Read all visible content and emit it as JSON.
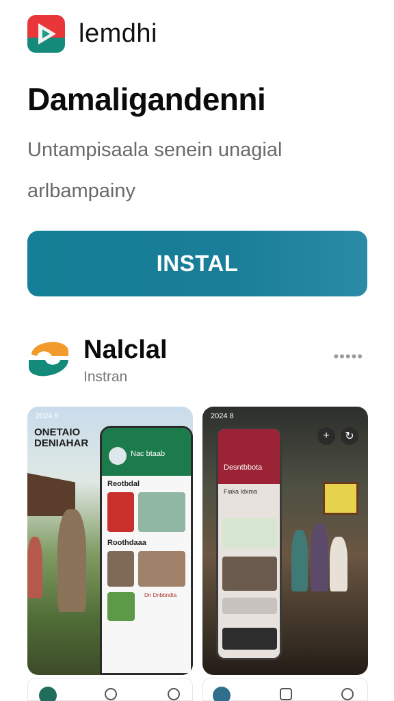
{
  "app": {
    "name": "lemdhi",
    "title": "Damaligandenni",
    "subtitle_line1": "Untampisaala senein unagial",
    "subtitle_line2": "arlbampainy",
    "install_label": "INSTAL"
  },
  "related_app": {
    "name": "Nalclal",
    "subtitle": "Instran",
    "more_label": "•••••"
  },
  "screenshots": [
    {
      "status_time": "2024 8",
      "overlay_text_line1": "ONETAIO",
      "overlay_text_line2": "DENIAHAR",
      "phone_header": "Nac btaab",
      "section1": "Reotbdal",
      "section2": "Roothdaaa",
      "caption": "Dn Dnbbndta"
    },
    {
      "status_time": "2024 8",
      "phone_header": "Desntbbota",
      "card_label": "Fiaka Idxma"
    }
  ],
  "colors": {
    "install_button": "#1a7e99",
    "logo_red": "#e8363a",
    "logo_teal": "#138a7a",
    "logo_orange": "#f29a2e"
  },
  "icons": [
    "play-icon",
    "more-icon",
    "plus-icon",
    "back-icon",
    "home-icon",
    "search-icon",
    "profile-icon"
  ]
}
